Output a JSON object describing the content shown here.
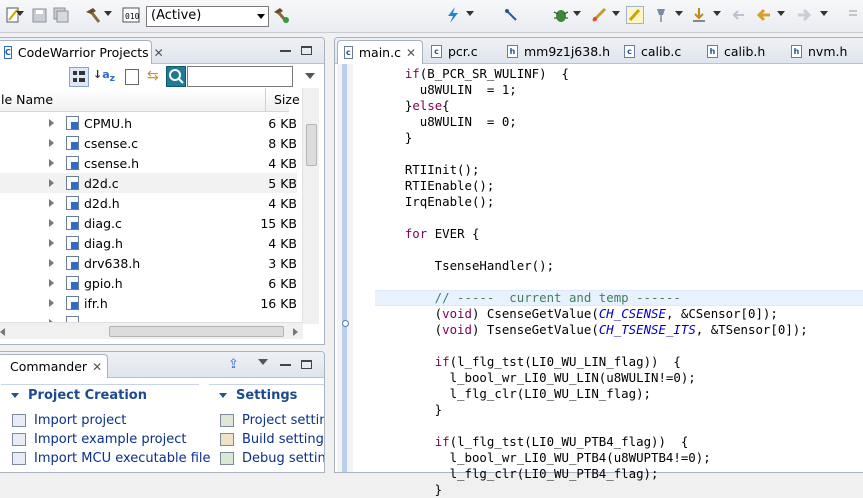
{
  "toolbar": {
    "config_value": "(Active)",
    "icons": [
      "new-file-icon",
      "save-icon",
      "save-all-icon",
      "hammer-build-icon",
      "build-config-icon",
      "build-all-icon",
      "flash-icon",
      "debug-icon",
      "bug-icon",
      "launch-icon",
      "highlight-icon",
      "annotation-nav-icon",
      "back-icon",
      "forward-icon"
    ]
  },
  "projects_panel": {
    "title": "CodeWarrior Projects",
    "columns": {
      "name": "le Name",
      "size": "Size"
    },
    "files": [
      {
        "name": "CPMU.h",
        "size": "6 KB"
      },
      {
        "name": "csense.c",
        "size": "8 KB"
      },
      {
        "name": "csense.h",
        "size": "4 KB"
      },
      {
        "name": "d2d.c",
        "size": "5 KB"
      },
      {
        "name": "d2d.h",
        "size": "4 KB"
      },
      {
        "name": "diag.c",
        "size": "15 KB"
      },
      {
        "name": "diag.h",
        "size": "4 KB"
      },
      {
        "name": "drv638.h",
        "size": "3 KB"
      },
      {
        "name": "gpio.h",
        "size": "6 KB"
      },
      {
        "name": "ifr.h",
        "size": "16 KB"
      }
    ]
  },
  "commander_panel": {
    "title": "Commander",
    "project_creation": {
      "title": "Project Creation",
      "items": [
        "Import project",
        "Import example project",
        "Import MCU executable file"
      ]
    },
    "settings": {
      "title": "Settings",
      "items": [
        "Project setting",
        "Build settings",
        "Debug setting"
      ]
    }
  },
  "editor": {
    "tabs": [
      "main.c",
      "pcr.c",
      "mm9z1j638.h",
      "calib.c",
      "calib.h",
      "nvm.h"
    ],
    "code_lines": [
      "    if(B_PCR_SR_WULINF)  {",
      "      u8WULIN  = 1;",
      "    }else{",
      "      u8WULIN  = 0;",
      "    }",
      "",
      "    RTIInit();",
      "    RTIEnable();",
      "    IrqEnable();",
      "",
      "    for EVER {",
      "",
      "        TsenseHandler();",
      "",
      "        // -----  current and temp ------",
      "        (void) CsenseGetValue(CH_CSENSE, &CSensor[0]);",
      "        (void) TsenseGetValue(CH_TSENSE_ITS, &TSensor[0]);",
      "",
      "        if(l_flg_tst(LI0_WU_LIN_flag))  {",
      "          l_bool_wr_LI0_WU_LIN(u8WULIN!=0);",
      "          l_flg_clr(LI0_WU_LIN_flag);",
      "        }",
      "",
      "        if(l_flg_tst(LI0_WU_PTB4_flag))  {",
      "          l_bool_wr_LI0_WU_PTB4(u8WUPTB4!=0);",
      "          l_flg_clr(LI0_WU_PTB4_flag);",
      "        }"
    ]
  }
}
